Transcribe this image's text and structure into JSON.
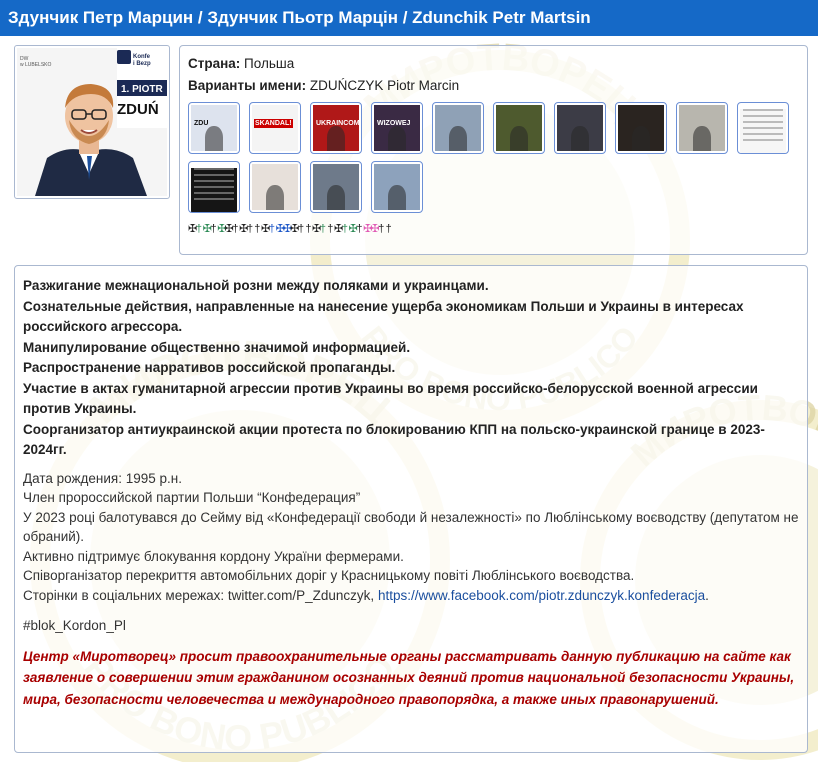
{
  "header": {
    "title": "Здунчик Петр Марцин / Здунчик Пьотр Марцін / Zdunchik Petr Martsin"
  },
  "profile_photo": {
    "sign_text": [
      "Konfe",
      "i Bezp"
    ],
    "badge_text": "1. PIOTR",
    "name_text": "ZDUŃ",
    "corner_text": "DW\nw LUBELSKO"
  },
  "info": {
    "country_label": "Страна:",
    "country_value": "Польша",
    "names_label": "Варианты имени:",
    "names_value": "ZDUŃCZYK Piotr Marcin"
  },
  "thumbnails": [
    {
      "name": "thumb-portrait",
      "bg": "#dde3ee",
      "text": "ZDU"
    },
    {
      "name": "thumb-skandal",
      "bg": "#f4f4f4",
      "text": "SKANDAL!"
    },
    {
      "name": "thumb-news-red",
      "bg": "#b01818",
      "text": "UKRAINCOM"
    },
    {
      "name": "thumb-person-dark",
      "bg": "#3a2a44",
      "text": "WIZOWEJ"
    },
    {
      "name": "thumb-street",
      "bg": "#8fa1b6",
      "text": ""
    },
    {
      "name": "thumb-group-vests",
      "bg": "#4e5a2e",
      "text": ""
    },
    {
      "name": "thumb-crowd",
      "bg": "#3c3c46",
      "text": ""
    },
    {
      "name": "thumb-man-glasses",
      "bg": "#2a2420",
      "text": ""
    },
    {
      "name": "thumb-line-people",
      "bg": "#b8b6ae",
      "text": ""
    },
    {
      "name": "thumb-document",
      "bg": "#f6f6f6",
      "text": ""
    },
    {
      "name": "thumb-dark-text",
      "bg": "#151515",
      "text": ""
    },
    {
      "name": "thumb-protest-flags",
      "bg": "#e7e0da",
      "text": ""
    },
    {
      "name": "thumb-group-outdoor",
      "bg": "#6e7a8a",
      "text": ""
    },
    {
      "name": "thumb-church",
      "bg": "#8da2bc",
      "text": ""
    }
  ],
  "crosses": [
    {
      "glyph": "✠",
      "color": "#222"
    },
    {
      "glyph": "†",
      "color": "#2e8b57"
    },
    {
      "glyph": "✠",
      "color": "#2e8b57"
    },
    {
      "glyph": "†",
      "color": "#222"
    },
    {
      "glyph": "✠",
      "color": "#2e8b57"
    },
    {
      "glyph": "✠",
      "color": "#222"
    },
    {
      "glyph": "†",
      "color": "#222"
    },
    {
      "glyph": "✠",
      "color": "#222"
    },
    {
      "glyph": "†",
      "color": "#222"
    },
    {
      "glyph": "†",
      "color": "#222"
    },
    {
      "glyph": "✠",
      "color": "#222"
    },
    {
      "glyph": "†",
      "color": "#1e58c8"
    },
    {
      "glyph": "✠",
      "color": "#1e58c8"
    },
    {
      "glyph": "✠",
      "color": "#1e58c8"
    },
    {
      "glyph": "✠",
      "color": "#222"
    },
    {
      "glyph": "†",
      "color": "#222"
    },
    {
      "glyph": "†",
      "color": "#222"
    },
    {
      "glyph": "✠",
      "color": "#222"
    },
    {
      "glyph": "†",
      "color": "#2e8b57"
    },
    {
      "glyph": "†",
      "color": "#222"
    },
    {
      "glyph": "✠",
      "color": "#222"
    },
    {
      "glyph": "†",
      "color": "#2e8b57"
    },
    {
      "glyph": "✠",
      "color": "#2e8b57"
    },
    {
      "glyph": "†",
      "color": "#222"
    },
    {
      "glyph": "✠",
      "color": "#e05ab5"
    },
    {
      "glyph": "✠",
      "color": "#e05ab5"
    },
    {
      "glyph": "†",
      "color": "#222"
    },
    {
      "glyph": "†",
      "color": "#222"
    }
  ],
  "charges": [
    "Разжигание межнациональной розни между поляками и украинцами.",
    "Сознательные действия, направленные на нанесение ущерба экономикам Польши и Украины в интересах российского агрессора.",
    "Манипулирование общественно значимой информацией.",
    "Распространение нарративов российской пропаганды.",
    "Участие в актах гуманитарной агрессии против Украины во время российско-белорусской военной агрессии против Украины.",
    "Соорганизатор антиукраинской акции протеста по блокированию КПП на польско-украинской границе в 2023-2024гг."
  ],
  "bio": [
    "Дата рождения: 1995 р.н.",
    "Член пророссийской партии Польши “Конфедерация”",
    "У 2023 році балотувався до Сейму від «Конфедерації свободи й незалежності» по Люблінському воєводству (депутатом не обраний).",
    "Активно підтримує блокування кордону України фермерами.",
    "Співорганізатор перекриття автомобільних доріг у Красницькому повіті Люблінського воєводства."
  ],
  "social": {
    "prefix": "Сторінки в соціальних мережах: twitter.com/P_Zdunczyk, ",
    "link": "https://www.facebook.com/piotr.zdunczyk.konfederacja",
    "suffix": "."
  },
  "hashtag": "#blok_Kordon_Pl",
  "warning": "Центр «Миротворец» просит правоохранительные органы рассматривать данную публикацию на сайте как заявление о совершении этим гражданином осознанных деяний против национальной безопасности Украины, мира, безопасности человечества и международного правопорядка, а также иных правонарушений.",
  "watermark": {
    "ring_top": "МИРОТВОРЕЦ",
    "ring_bottom": "PRO BONO PUBLICO",
    "color": "#efe6b4"
  }
}
